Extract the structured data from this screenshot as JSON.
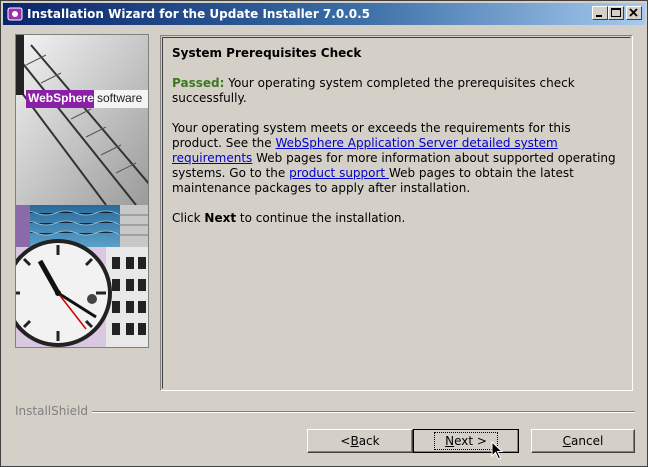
{
  "window": {
    "title": "Installation Wizard for the Update Installer 7.0.0.5"
  },
  "side_image": {
    "brand_name": "WebSphere.",
    "brand_suffix": "software"
  },
  "content": {
    "heading": "System Prerequisites Check",
    "passed_label": "Passed:",
    "passed_text": " Your operating system completed the prerequisites check successfully.",
    "para2_part1": "Your operating system meets or exceeds the requirements for this product. See the ",
    "para2_link1": "WebSphere Application Server detailed system requirements",
    "para2_part2": " Web pages for more information about supported operating systems. Go to the ",
    "para2_link2": "product support ",
    "para2_part3": "Web pages to obtain the latest maintenance packages to apply after installation.",
    "para3_part1": "Click ",
    "para3_bold": "Next",
    "para3_part2": " to continue the installation."
  },
  "footer": {
    "installshield_label": "InstallShield"
  },
  "buttons": {
    "back_prefix": "< ",
    "back_mnemonic": "B",
    "back_rest": "ack",
    "next_mnemonic": "N",
    "next_rest": "ext >",
    "cancel_mnemonic": "C",
    "cancel_rest": "ancel"
  },
  "colors": {
    "titlebar_start": "#0a246a",
    "titlebar_end": "#a6caf0",
    "passed": "#3b7a1e",
    "link": "#0000cc",
    "websphere_badge": "#8b1fa8"
  }
}
